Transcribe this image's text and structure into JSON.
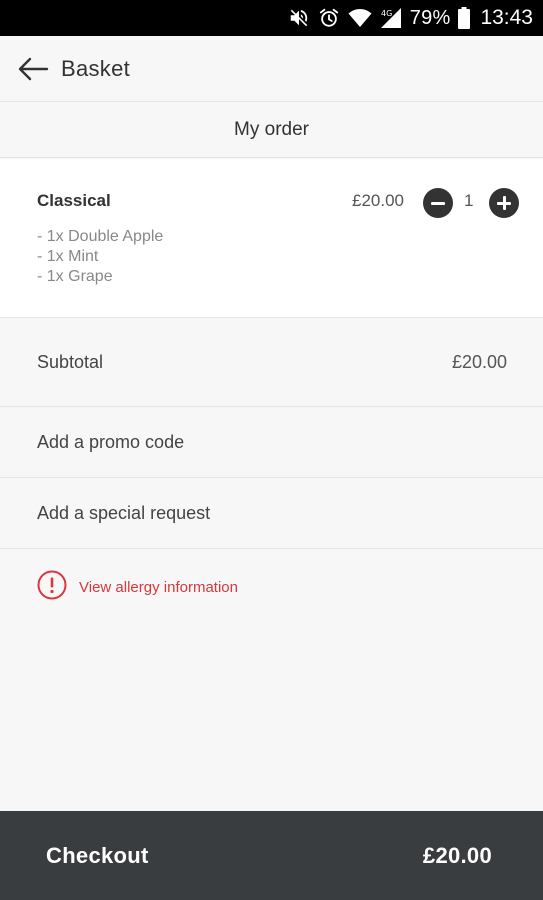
{
  "status": {
    "battery": "79%",
    "time": "13:43",
    "network": "4G"
  },
  "header": {
    "title": "Basket"
  },
  "section": {
    "title": "My order"
  },
  "order": {
    "item_name": "Classical",
    "modifiers": [
      "- 1x Double Apple",
      "- 1x Mint",
      "- 1x Grape"
    ],
    "price": "£20.00",
    "quantity": "1"
  },
  "summary": {
    "subtotal_label": "Subtotal",
    "subtotal_value": "£20.00",
    "promo_label": "Add a promo code",
    "special_label": "Add a special request",
    "allergy_label": "View allergy information"
  },
  "checkout": {
    "label": "Checkout",
    "total": "£20.00"
  },
  "colors": {
    "accent_red": "#d9373c",
    "checkout_bg": "#3a3d40"
  }
}
